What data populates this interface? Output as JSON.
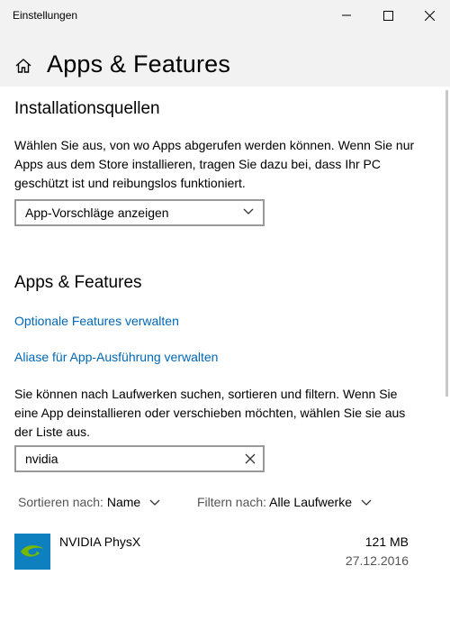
{
  "window": {
    "title": "Einstellungen"
  },
  "header": {
    "title": "Apps & Features"
  },
  "sources": {
    "heading": "Installationsquellen",
    "description": "Wählen Sie aus, von wo Apps abgerufen werden können. Wenn Sie nur Apps aus dem Store installieren, tragen Sie dazu bei, dass Ihr PC geschützt ist und reibungslos funktioniert.",
    "selected": "App-Vorschläge anzeigen"
  },
  "apps": {
    "heading": "Apps & Features",
    "link_optional": "Optionale Features verwalten",
    "link_alias": "Aliase für App-Ausführung verwalten",
    "description": "Sie können nach Laufwerken suchen, sortieren und filtern. Wenn Sie eine App deinstallieren oder verschieben möchten, wählen Sie sie aus der Liste aus.",
    "search_value": "nvidia",
    "sort_label": "Sortieren nach:",
    "sort_value": "Name",
    "filter_label": "Filtern nach:",
    "filter_value": "Alle Laufwerke",
    "items": [
      {
        "name": "NVIDIA PhysX",
        "size": "121 MB",
        "date": "27.12.2016",
        "icon": "nvidia-icon"
      }
    ]
  },
  "colors": {
    "link": "#0067b8",
    "header_bg": "#f2f2f2",
    "nvidia_blue": "#0e7fbf",
    "nvidia_green": "#76b900"
  }
}
